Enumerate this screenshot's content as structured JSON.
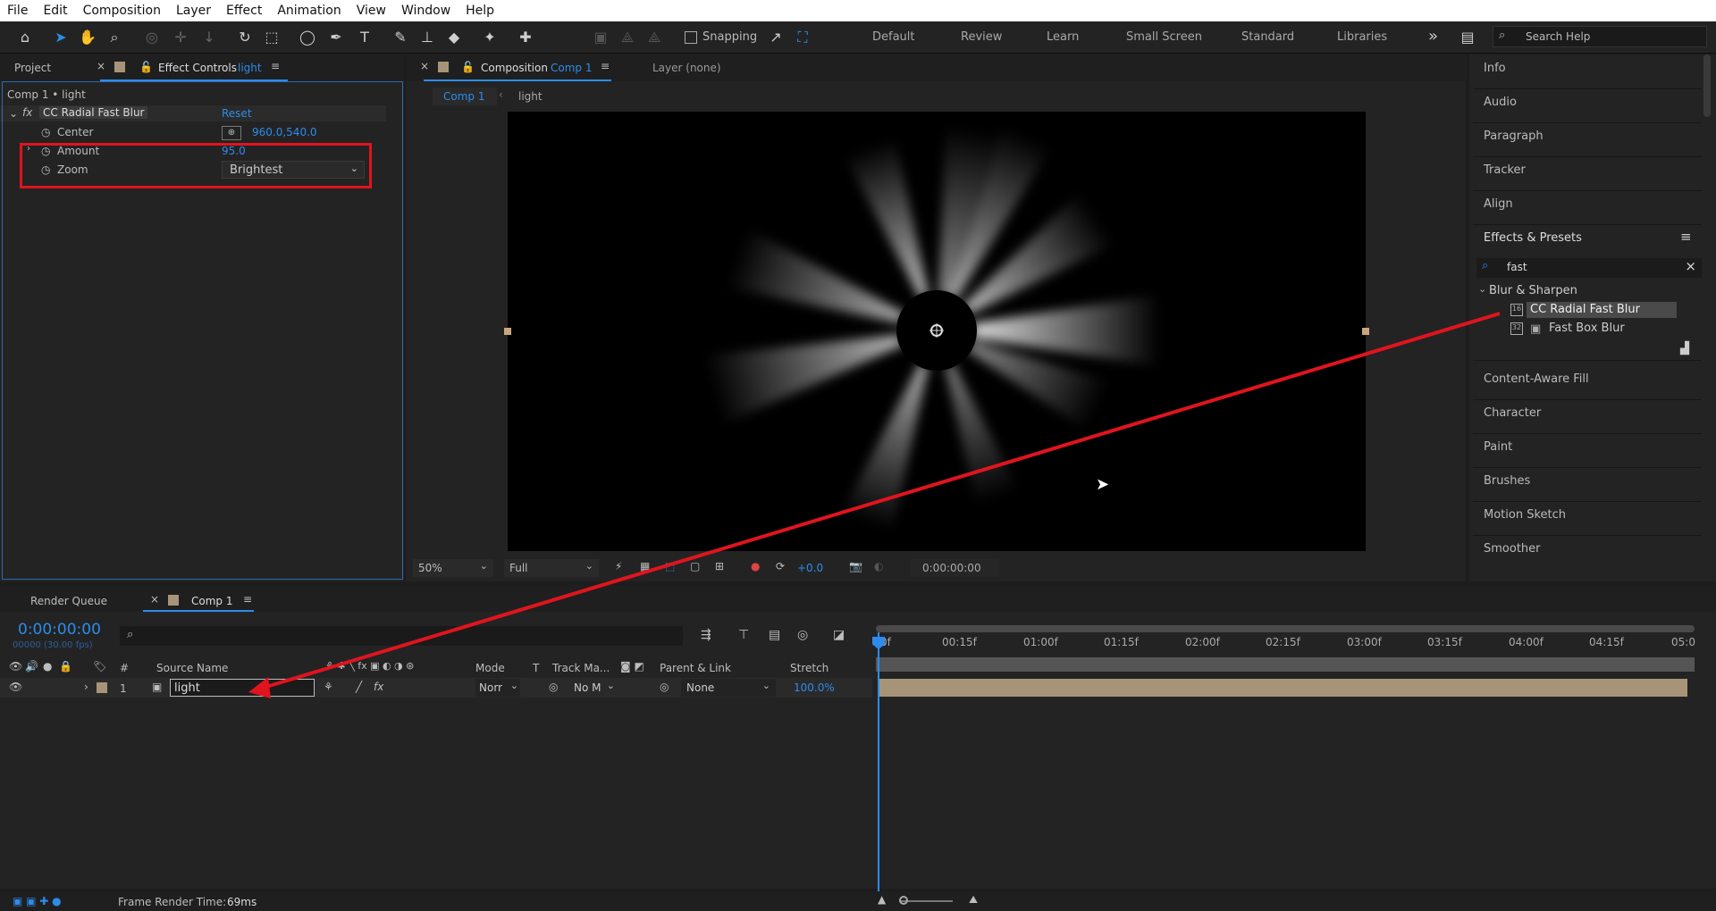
{
  "menu": [
    "File",
    "Edit",
    "Composition",
    "Layer",
    "Effect",
    "Animation",
    "View",
    "Window",
    "Help"
  ],
  "toolbar": {
    "snapping": "Snapping",
    "workspaces": [
      "Default",
      "Review",
      "Learn",
      "Small Screen",
      "Standard",
      "Libraries"
    ],
    "more": "»",
    "search_placeholder": "Search Help"
  },
  "left_panel": {
    "tab_project": "Project",
    "tab_effect_controls": "Effect Controls",
    "tab_effect_layer": "light",
    "breadcrumb": "Comp 1 • light",
    "effect": {
      "name": "CC Radial Fast Blur",
      "reset": "Reset",
      "props": [
        {
          "label": "Center",
          "value": "960.0,540.0"
        },
        {
          "label": "Amount",
          "value": "95.0"
        },
        {
          "label": "Zoom",
          "value": "Brightest"
        }
      ]
    }
  },
  "comp_panel": {
    "tab_label": "Composition",
    "tab_comp": "Comp 1",
    "layer_tab": "Layer (none)",
    "breadcrumb": [
      "Comp 1",
      "light"
    ],
    "zoom": "50%",
    "resolution": "Full",
    "exposure": "+0.0",
    "timecode": "0:00:00:00"
  },
  "right_panel": {
    "items_top": [
      "Info",
      "Audio",
      "Paragraph",
      "Tracker",
      "Align"
    ],
    "effects_presets": "Effects & Presets",
    "search": "fast",
    "category": "Blur & Sharpen",
    "results": [
      "CC Radial Fast Blur",
      "Fast Box Blur"
    ],
    "items_bottom": [
      "Content-Aware Fill",
      "Character",
      "Paint",
      "Brushes",
      "Motion Sketch",
      "Smoother"
    ]
  },
  "timeline": {
    "tab_render_queue": "Render Queue",
    "tab_comp": "Comp 1",
    "timecode": "0:00:00:00",
    "frames": "00000 (30.00 fps)",
    "columns": {
      "num": "#",
      "source": "Source Name",
      "mode": "Mode",
      "t": "T",
      "track": "Track Ma...",
      "parent": "Parent & Link",
      "stretch": "Stretch"
    },
    "layer": {
      "num": "1",
      "name": "light",
      "mode": "Norr",
      "track": "No M",
      "parent": "None",
      "stretch": "100.0%"
    },
    "ruler": [
      "0f",
      "00:15f",
      "01:00f",
      "01:15f",
      "02:00f",
      "02:15f",
      "03:00f",
      "03:15f",
      "04:00f",
      "04:15f",
      "05:0"
    ]
  },
  "status": {
    "label": "Frame Render Time:",
    "value": "69ms"
  },
  "colors": {
    "accent": "#2d8ceb",
    "highlight": "#e0141e",
    "layer_bar": "#a79478"
  }
}
